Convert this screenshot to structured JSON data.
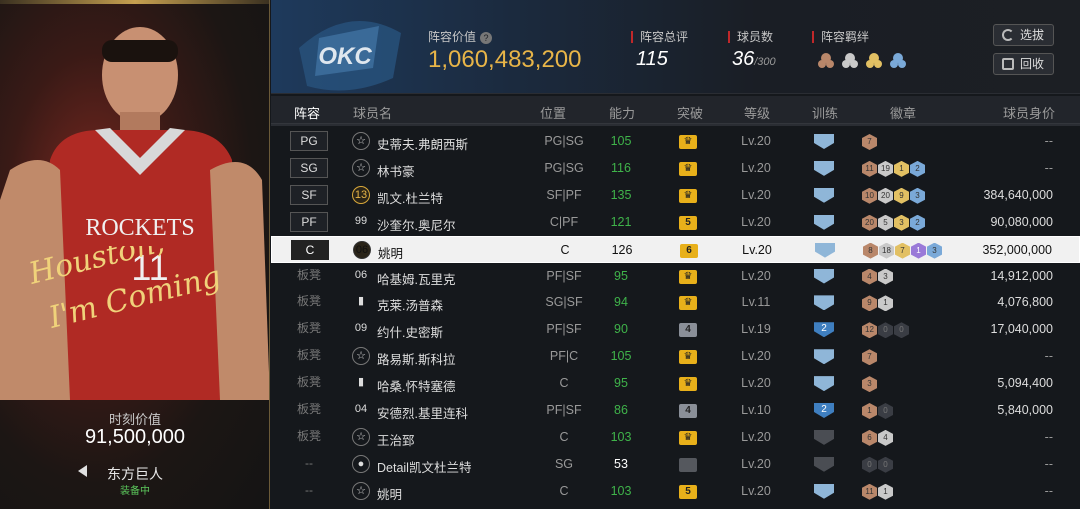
{
  "left_panel": {
    "script_line1": "Houston,",
    "script_line2": "I'm Coming",
    "moment_value_label": "时刻价值",
    "moment_value": "91,500,000",
    "skin_name": "东方巨人",
    "equipped_label": "装备中",
    "jersey_text": "ROCKETS"
  },
  "header": {
    "logo_text": "OKC",
    "lineup_value_label": "阵容价值",
    "lineup_value": "1,060,483,200",
    "rating_label": "阵容总评",
    "rating": "115",
    "player_count_label": "球员数",
    "player_count": "36",
    "player_count_max": "/300",
    "bond_label": "阵容羁绊",
    "btn_select": "选拔",
    "btn_recycle": "回收"
  },
  "columns": [
    "阵容",
    "球员名",
    "位置",
    "能力",
    "突破",
    "等级",
    "训练",
    "徽章",
    "球员身价"
  ],
  "rows": [
    {
      "slot": "PG",
      "icon": "star",
      "name": "史蒂夫.弗朗西斯",
      "pos": "PG|SG",
      "ability": "105",
      "ab_color": "green",
      "breaker": "crown",
      "breaker_style": "gold",
      "level": "Lv.20",
      "train": "plain",
      "badges": [
        [
          "br",
          "7"
        ]
      ],
      "worth": "--"
    },
    {
      "slot": "SG",
      "icon": "star",
      "name": "林书豪",
      "pos": "PG|SG",
      "ability": "116",
      "ab_color": "green",
      "breaker": "crown",
      "breaker_style": "gold",
      "level": "Lv.20",
      "train": "plain",
      "badges": [
        [
          "br",
          "11"
        ],
        [
          "si",
          "19"
        ],
        [
          "go",
          "1"
        ],
        [
          "bl",
          "2"
        ]
      ],
      "worth": "--"
    },
    {
      "slot": "SF",
      "icon": "13",
      "name": "凯文.杜兰特",
      "pos": "SF|PF",
      "ability": "135",
      "ab_color": "green",
      "breaker": "crown",
      "breaker_style": "gold",
      "level": "Lv.20",
      "train": "plain",
      "badges": [
        [
          "br",
          "10"
        ],
        [
          "si",
          "20"
        ],
        [
          "go",
          "9"
        ],
        [
          "bl",
          "3"
        ]
      ],
      "worth": "384,640,000"
    },
    {
      "slot": "PF",
      "icon": "99",
      "name": "沙奎尔.奥尼尔",
      "pos": "C|PF",
      "ability": "121",
      "ab_color": "green",
      "breaker": "5",
      "breaker_style": "gold",
      "level": "Lv.20",
      "train": "plain",
      "badges": [
        [
          "br",
          "20"
        ],
        [
          "si",
          "5"
        ],
        [
          "go",
          "3"
        ],
        [
          "bl",
          "2"
        ]
      ],
      "worth": "90,080,000"
    },
    {
      "slot": "C",
      "icon": "06",
      "name": "姚明",
      "pos": "C",
      "ability": "126",
      "ab_color": "dark",
      "breaker": "6",
      "breaker_style": "gold",
      "level": "Lv.20",
      "train": "plain",
      "badges": [
        [
          "br",
          "8"
        ],
        [
          "si",
          "18"
        ],
        [
          "go",
          "7"
        ],
        [
          "pu",
          "1"
        ],
        [
          "bl",
          "3"
        ]
      ],
      "worth": "352,000,000",
      "highlight": true
    },
    {
      "slot": "板凳",
      "icon": "06",
      "name": "哈基姆.瓦里克",
      "pos": "PF|SF",
      "ability": "95",
      "ab_color": "green",
      "breaker": "crown",
      "breaker_style": "gold",
      "level": "Lv.20",
      "train": "plain",
      "badges": [
        [
          "br",
          "4"
        ],
        [
          "si",
          "3"
        ]
      ],
      "worth": "14,912,000"
    },
    {
      "slot": "板凳",
      "icon": "bars",
      "name": "克莱.汤普森",
      "pos": "SG|SF",
      "ability": "94",
      "ab_color": "green",
      "breaker": "crown",
      "breaker_style": "gold",
      "level": "Lv.11",
      "train": "plain",
      "badges": [
        [
          "br",
          "9"
        ],
        [
          "si",
          "1"
        ]
      ],
      "worth": "4,076,800"
    },
    {
      "slot": "板凳",
      "icon": "09",
      "name": "约什.史密斯",
      "pos": "PF|SF",
      "ability": "90",
      "ab_color": "green",
      "breaker": "4",
      "breaker_style": "grey",
      "level": "Lv.19",
      "train": "2",
      "badges": [
        [
          "br",
          "12"
        ],
        [
          "dk",
          "0"
        ],
        [
          "dk",
          "0"
        ]
      ],
      "worth": "17,040,000"
    },
    {
      "slot": "板凳",
      "icon": "star",
      "name": "路易斯.斯科拉",
      "pos": "PF|C",
      "ability": "105",
      "ab_color": "green",
      "breaker": "crown",
      "breaker_style": "gold",
      "level": "Lv.20",
      "train": "plain",
      "badges": [
        [
          "br",
          "7"
        ]
      ],
      "worth": "--"
    },
    {
      "slot": "板凳",
      "icon": "bars",
      "name": "哈桑.怀特塞德",
      "pos": "C",
      "ability": "95",
      "ab_color": "green",
      "breaker": "crown",
      "breaker_style": "gold",
      "level": "Lv.20",
      "train": "plain",
      "badges": [
        [
          "br",
          "3"
        ]
      ],
      "worth": "5,094,400"
    },
    {
      "slot": "板凳",
      "icon": "04",
      "name": "安德烈.基里连科",
      "pos": "PF|SF",
      "ability": "86",
      "ab_color": "green",
      "breaker": "4",
      "breaker_style": "grey",
      "level": "Lv.10",
      "train": "2",
      "badges": [
        [
          "br",
          "1"
        ],
        [
          "dk",
          "0"
        ]
      ],
      "worth": "5,840,000"
    },
    {
      "slot": "板凳",
      "icon": "star",
      "name": "王治郅",
      "pos": "C",
      "ability": "103",
      "ab_color": "green",
      "breaker": "crown",
      "breaker_style": "gold",
      "level": "Lv.20",
      "train": "dim",
      "badges": [
        [
          "br",
          "6"
        ],
        [
          "si",
          "4"
        ]
      ],
      "worth": "--"
    },
    {
      "slot": "--",
      "icon": "person",
      "name": "Detail凯文杜兰特",
      "pos": "SG",
      "ability": "53",
      "ab_color": "white",
      "breaker": "",
      "breaker_style": "dim",
      "level": "Lv.20",
      "train": "dim",
      "badges": [
        [
          "dk",
          "0"
        ],
        [
          "dk",
          "0"
        ]
      ],
      "worth": "--"
    },
    {
      "slot": "--",
      "icon": "star",
      "name": "姚明",
      "pos": "C",
      "ability": "103",
      "ab_color": "green",
      "breaker": "5",
      "breaker_style": "gold",
      "level": "Lv.20",
      "train": "plain",
      "badges": [
        [
          "br",
          "11"
        ],
        [
          "si",
          "1"
        ]
      ],
      "worth": "--"
    }
  ]
}
